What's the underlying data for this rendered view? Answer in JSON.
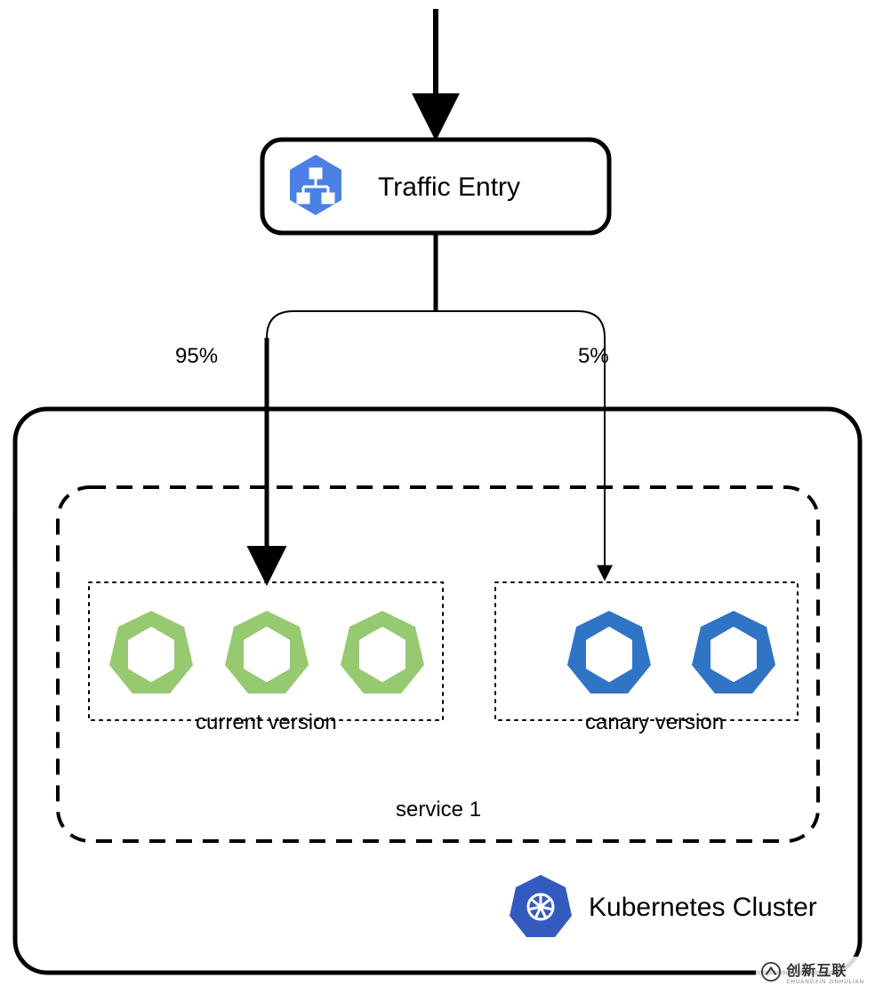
{
  "traffic_entry": {
    "label": "Traffic Entry"
  },
  "split": {
    "left_pct": "95%",
    "right_pct": "5%"
  },
  "service": {
    "label": "service 1"
  },
  "groups": {
    "current": {
      "label": "current version",
      "pods": 3,
      "color": "#97C971"
    },
    "canary": {
      "label": "canary version",
      "pods": 2,
      "color": "#3074C6"
    }
  },
  "cluster": {
    "label": "Kubernetes Cluster"
  },
  "icons": {
    "hexagon_blue": "#4B80E4",
    "k8s_blue": "#335BBF"
  },
  "watermark": {
    "brand_cn": "创新互联",
    "brand_en": "CHUANGXIN JINHULIAN"
  }
}
